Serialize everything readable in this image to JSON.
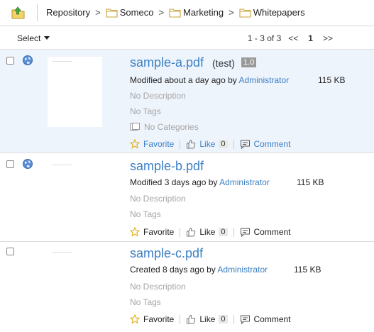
{
  "breadcrumb": {
    "items": [
      "Repository",
      "Someco",
      "Marketing",
      "Whitepapers"
    ],
    "separator": ">"
  },
  "toolbar": {
    "select_label": "Select",
    "range": "1 - 3 of 3",
    "prev": "<<",
    "page": "1",
    "next": ">>"
  },
  "documents": [
    {
      "name": "sample-a.pdf",
      "note": "(test)",
      "version": "1.0",
      "modified": "Modified about a day ago by",
      "user": "Administrator",
      "size": "115 KB",
      "description": "No Description",
      "tags": "No Tags",
      "categories": "No Categories",
      "favorite": "Favorite",
      "like": "Like",
      "like_count": "0",
      "comment": "Comment"
    },
    {
      "name": "sample-b.pdf",
      "modified": "Modified 3 days ago by",
      "user": "Administrator",
      "size": "115 KB",
      "description": "No Description",
      "tags": "No Tags",
      "favorite": "Favorite",
      "like": "Like",
      "like_count": "0",
      "comment": "Comment"
    },
    {
      "name": "sample-c.pdf",
      "modified": "Created 8 days ago by",
      "user": "Administrator",
      "size": "115 KB",
      "description": "No Description",
      "tags": "No Tags",
      "favorite": "Favorite",
      "like": "Like",
      "like_count": "0",
      "comment": "Comment"
    }
  ],
  "colors": {
    "link": "#3c80c4",
    "selected_row": "#eef4fc",
    "muted": "#a5a5a5"
  },
  "icons": [
    "folder-up-icon",
    "folder-icon",
    "globe-icon",
    "star-icon",
    "thumbs-up-icon",
    "comment-icon",
    "category-icon"
  ]
}
